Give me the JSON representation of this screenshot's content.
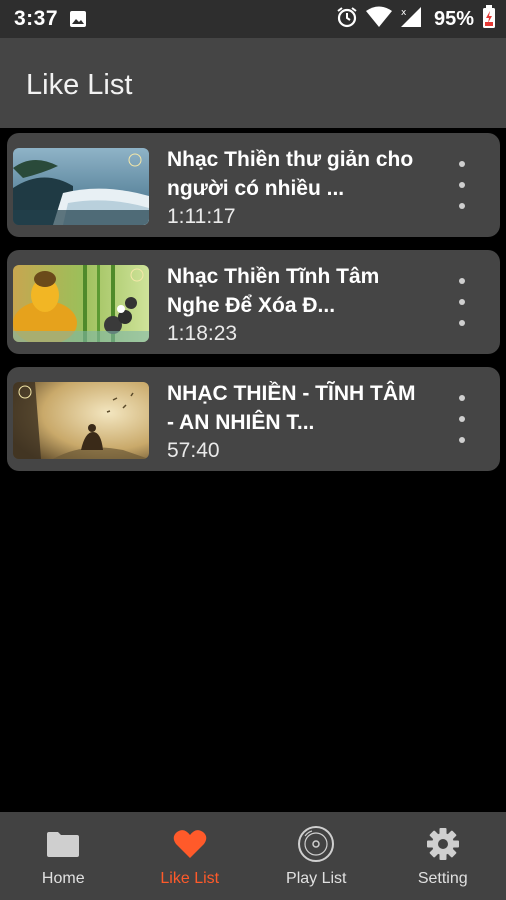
{
  "status_bar": {
    "time": "3:37",
    "battery": "95%",
    "icons": [
      "image-icon",
      "alarm-icon",
      "wifi-icon",
      "signal-icon",
      "battery-charging-icon"
    ]
  },
  "app_bar": {
    "title": "Like List"
  },
  "videos": [
    {
      "title": "Nhạc Thiền thư giản cho người có nhiều ...",
      "duration": "1:11:17",
      "thumbnail": "waterfall-landscape"
    },
    {
      "title": "Nhạc Thiền Tĩnh Tâm Nghe Để Xóa Đ...",
      "duration": "1:18:23",
      "thumbnail": "golden-buddha-bamboo"
    },
    {
      "title": "NHẠC THIỀN - TĨNH TÂM - AN NHIÊN T...",
      "duration": "57:40",
      "thumbnail": "monk-meditating"
    }
  ],
  "bottom_nav": [
    {
      "label": "Home",
      "icon": "folder-icon",
      "active": false
    },
    {
      "label": "Like List",
      "icon": "heart-icon",
      "active": true
    },
    {
      "label": "Play List",
      "icon": "disc-icon",
      "active": false
    },
    {
      "label": "Setting",
      "icon": "gear-icon",
      "active": false
    }
  ],
  "colors": {
    "accent": "#ff5a2a",
    "card": "#454545",
    "appbar": "#454545",
    "nav": "#424242"
  }
}
